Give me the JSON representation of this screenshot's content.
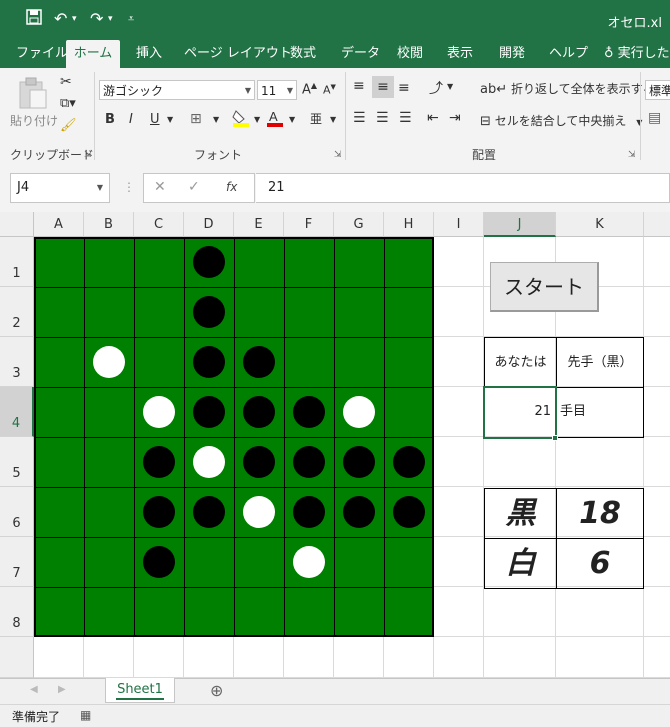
{
  "window": {
    "title": "オセロ.xl",
    "qat": {
      "save_icon": "save-icon",
      "undo_icon": "undo-icon",
      "redo_icon": "redo-icon"
    }
  },
  "tabs": [
    "ファイル",
    "ホーム",
    "挿入",
    "ページ レイアウト",
    "数式",
    "データ",
    "校閲",
    "表示",
    "開発",
    "ヘルプ",
    "実行したい"
  ],
  "ribbon": {
    "clipboard": {
      "paste": "貼り付け",
      "label": "クリップボード"
    },
    "font": {
      "name": "游ゴシック",
      "size": "11",
      "label": "フォント",
      "bold": "B",
      "italic": "I",
      "underline": "U"
    },
    "alignment": {
      "wrap": "折り返して全体を表示する",
      "merge": "セルを結合して中央揃え",
      "label": "配置"
    },
    "number": {
      "format": "標準"
    }
  },
  "formula_bar": {
    "name_box": "J4",
    "value": "21",
    "fx": "fx"
  },
  "columns": [
    "A",
    "B",
    "C",
    "D",
    "E",
    "F",
    "G",
    "H",
    "I",
    "J",
    "K"
  ],
  "rows": [
    "1",
    "2",
    "3",
    "4",
    "5",
    "6",
    "7",
    "8",
    "",
    ""
  ],
  "board": {
    "rows": [
      "...B....",
      "...B....",
      ".W.BB...",
      "..WBBBW.",
      "..BWBBBB",
      "..BBWBBB",
      "..B..W..",
      "........"
    ]
  },
  "panel": {
    "start_button": "スタート",
    "you_label": "あなたは",
    "turn_order": "先手（黒）",
    "move_number": "21",
    "move_suffix": "手目",
    "black_label": "黒",
    "black_count": "18",
    "white_label": "白",
    "white_count": "6"
  },
  "sheet": {
    "tab": "Sheet1"
  },
  "status": {
    "text": "準備完了"
  },
  "colors": {
    "excel_green": "#217346",
    "board_green": "#008000"
  }
}
